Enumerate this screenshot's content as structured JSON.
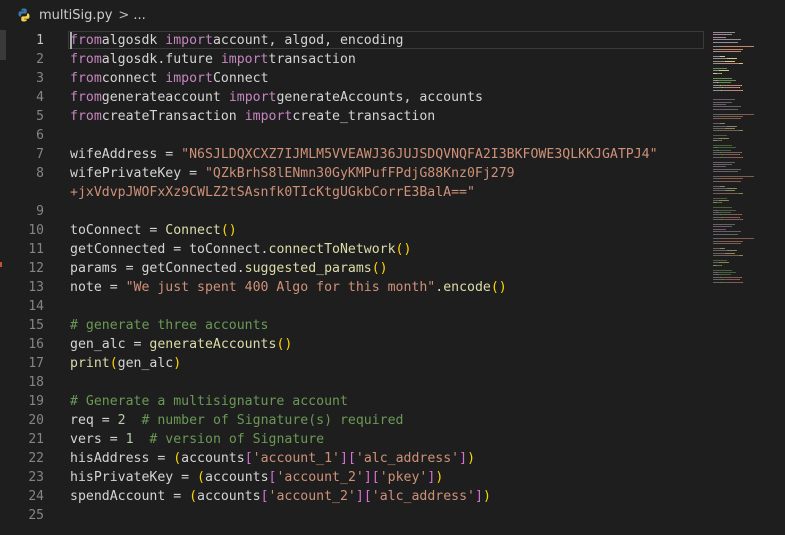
{
  "breadcrumb": {
    "file": "multiSig.py",
    "separator": ">",
    "more": "..."
  },
  "editor": {
    "active_line": 1,
    "lines": [
      {
        "n": "1",
        "tokens": [
          [
            "kw",
            "from"
          ],
          [
            "",
            "algosdk "
          ],
          [
            "kw",
            "import"
          ],
          [
            "",
            "account, algod, encoding"
          ]
        ]
      },
      {
        "n": "2",
        "tokens": [
          [
            "kw",
            "from"
          ],
          [
            "",
            "algosdk.future "
          ],
          [
            "kw",
            "import"
          ],
          [
            "",
            "transaction"
          ]
        ]
      },
      {
        "n": "3",
        "tokens": [
          [
            "kw",
            "from"
          ],
          [
            "",
            "connect "
          ],
          [
            "kw",
            "import"
          ],
          [
            "",
            "Connect"
          ]
        ]
      },
      {
        "n": "4",
        "tokens": [
          [
            "kw",
            "from"
          ],
          [
            "",
            "generateaccount "
          ],
          [
            "kw",
            "import"
          ],
          [
            "",
            "generateAccounts, accounts"
          ]
        ]
      },
      {
        "n": "5",
        "tokens": [
          [
            "kw",
            "from"
          ],
          [
            "",
            "createTransaction "
          ],
          [
            "kw",
            "import"
          ],
          [
            "",
            "create_transaction"
          ]
        ]
      },
      {
        "n": "6",
        "tokens": []
      },
      {
        "n": "7",
        "tokens": [
          [
            "",
            "wifeAddress = "
          ],
          [
            "str",
            "\"N6SJLDQXCXZ7IJMLM5VVEAWJ36JUJSDQVNQFA2I3BKFOWE3QLKKJGATPJ4\""
          ]
        ]
      },
      {
        "n": "8",
        "tokens": [
          [
            "",
            "wifePrivateKey = "
          ],
          [
            "str",
            "\"QZkBrhS8lENmn30GyKMPufFPdjG88Knz0Fj279"
          ]
        ]
      },
      {
        "n": "",
        "tokens": [
          [
            "str",
            "+jxVdvpJWOFxXz9CWLZ2tSAsnfk0TIcKtgUGkbCorrE3BalA==\""
          ]
        ]
      },
      {
        "n": "9",
        "tokens": []
      },
      {
        "n": "10",
        "tokens": [
          [
            "",
            "toConnect = "
          ],
          [
            "fn",
            "Connect"
          ],
          [
            "pa",
            "()"
          ]
        ]
      },
      {
        "n": "11",
        "tokens": [
          [
            "",
            "getConnected = toConnect."
          ],
          [
            "fn",
            "connectToNetwork"
          ],
          [
            "pa",
            "()"
          ]
        ]
      },
      {
        "n": "12",
        "tokens": [
          [
            "",
            "params = getConnected."
          ],
          [
            "fn",
            "suggested_params"
          ],
          [
            "pa",
            "()"
          ]
        ]
      },
      {
        "n": "13",
        "tokens": [
          [
            "",
            "note = "
          ],
          [
            "str",
            "\"We just spent 400 Algo for this month\""
          ],
          [
            "",
            "."
          ],
          [
            "fn",
            "encode"
          ],
          [
            "pa",
            "()"
          ]
        ]
      },
      {
        "n": "14",
        "tokens": []
      },
      {
        "n": "15",
        "tokens": [
          [
            "cm",
            "# generate three accounts"
          ]
        ]
      },
      {
        "n": "16",
        "tokens": [
          [
            "",
            "gen_alc = "
          ],
          [
            "fn",
            "generateAccounts"
          ],
          [
            "pa",
            "()"
          ]
        ]
      },
      {
        "n": "17",
        "tokens": [
          [
            "fn",
            "print"
          ],
          [
            "pa",
            "("
          ],
          [
            "",
            "gen_alc"
          ],
          [
            "pa",
            ")"
          ]
        ]
      },
      {
        "n": "18",
        "tokens": []
      },
      {
        "n": "19",
        "tokens": [
          [
            "cm",
            "# Generate a multisignature account"
          ]
        ]
      },
      {
        "n": "20",
        "tokens": [
          [
            "",
            "req = "
          ],
          [
            "num",
            "2"
          ],
          [
            "",
            "  "
          ],
          [
            "cm",
            "# number of Signature(s) required"
          ]
        ]
      },
      {
        "n": "21",
        "tokens": [
          [
            "",
            "vers = "
          ],
          [
            "num",
            "1"
          ],
          [
            "",
            "  "
          ],
          [
            "cm",
            "# version of Signature"
          ]
        ]
      },
      {
        "n": "22",
        "tokens": [
          [
            "",
            "hisAddress = "
          ],
          [
            "pa",
            "("
          ],
          [
            "",
            "accounts"
          ],
          [
            "pb",
            "["
          ],
          [
            "str",
            "'account_1'"
          ],
          [
            "pb",
            "]["
          ],
          [
            "str",
            "'alc_address'"
          ],
          [
            "pb",
            "]"
          ],
          [
            "pa",
            ")"
          ]
        ]
      },
      {
        "n": "23",
        "tokens": [
          [
            "",
            "hisPrivateKey = "
          ],
          [
            "pa",
            "("
          ],
          [
            "",
            "accounts"
          ],
          [
            "pb",
            "["
          ],
          [
            "str",
            "'account_2'"
          ],
          [
            "pb",
            "]["
          ],
          [
            "str",
            "'pkey'"
          ],
          [
            "pb",
            "]"
          ],
          [
            "pa",
            ")"
          ]
        ]
      },
      {
        "n": "24",
        "tokens": [
          [
            "",
            "spendAccount = "
          ],
          [
            "pa",
            "("
          ],
          [
            "",
            "accounts"
          ],
          [
            "pb",
            "["
          ],
          [
            "str",
            "'account_2'"
          ],
          [
            "pb",
            "]["
          ],
          [
            "str",
            "'alc_address'"
          ],
          [
            "pb",
            "]"
          ],
          [
            "pa",
            ")"
          ]
        ]
      },
      {
        "n": "25",
        "tokens": []
      }
    ]
  },
  "colors": {
    "background": "#1e1e1e",
    "keyword": "#c586c0",
    "string": "#ce9178",
    "function": "#dcdcaa",
    "comment": "#6a9955",
    "number": "#b5cea8"
  },
  "icons": {
    "file": "python-icon",
    "minimap": "minimap"
  }
}
